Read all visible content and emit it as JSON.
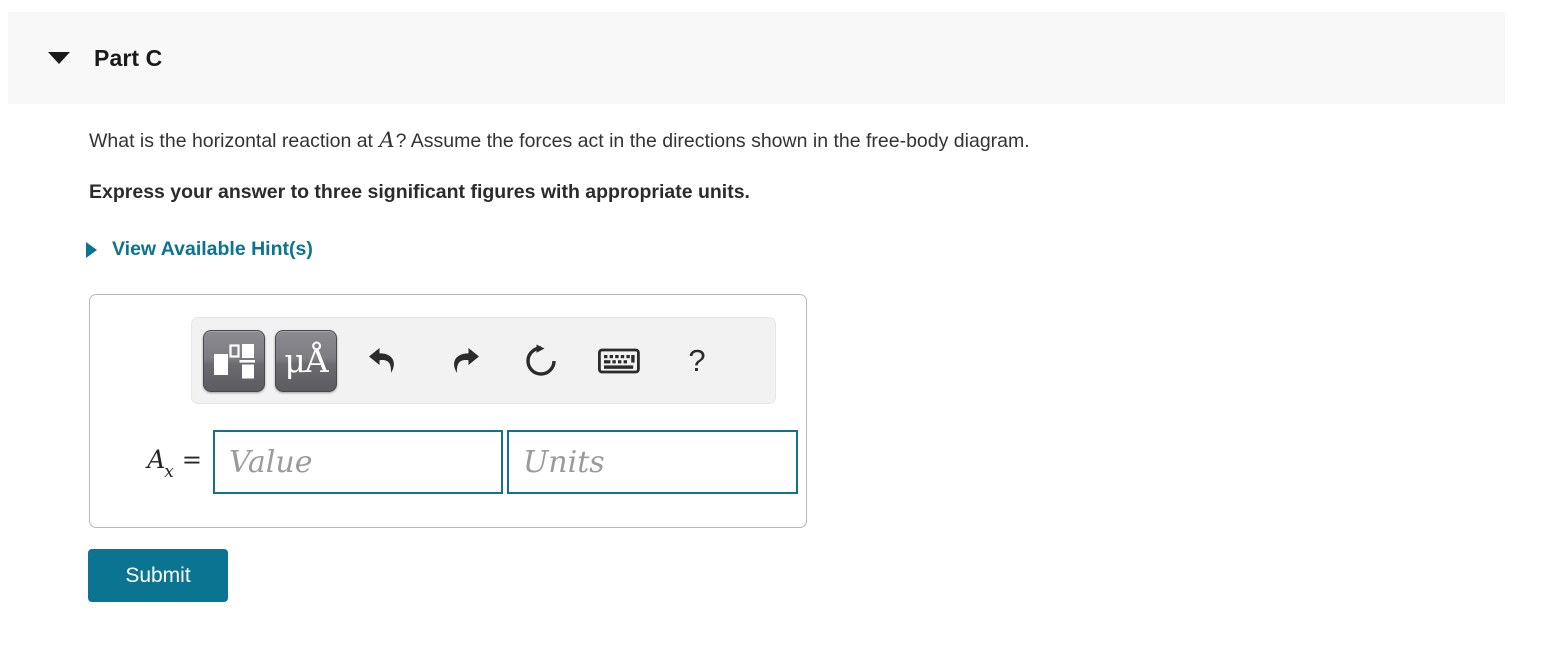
{
  "header": {
    "title": "Part C",
    "collapse_icon": "triangle-down-icon",
    "expanded": true,
    "background": "#f8f8f8"
  },
  "question": {
    "prompt_before_var": "What is the horizontal reaction at ",
    "prompt_variable": "A",
    "prompt_after_var": "? Assume the forces act in the directions shown in the free-body diagram.",
    "instruction": "Express your answer to three significant figures with appropriate units."
  },
  "hints": {
    "label": "View Available Hint(s)",
    "expand_icon": "triangle-right-icon",
    "color": "#0b7490"
  },
  "answer": {
    "toolbar": {
      "buttons": [
        {
          "name": "math-template-button",
          "icon": "math-template-icon",
          "label": ""
        },
        {
          "name": "units-button",
          "icon": "micro-angstrom-icon",
          "label": "μÅ"
        },
        {
          "name": "undo-button",
          "icon": "undo-arrow-icon",
          "label": ""
        },
        {
          "name": "redo-button",
          "icon": "redo-arrow-icon",
          "label": ""
        },
        {
          "name": "reset-button",
          "icon": "reset-circular-arrow-icon",
          "label": ""
        },
        {
          "name": "keyboard-button",
          "icon": "keyboard-icon",
          "label": ""
        },
        {
          "name": "help-button",
          "icon": "question-mark-icon",
          "label": "?"
        }
      ]
    },
    "variable_base": "A",
    "variable_subscript": "x",
    "equals": "=",
    "value_placeholder": "Value",
    "value_current": "",
    "units_placeholder": "Units",
    "units_current": "",
    "field_border_color": "#14708d"
  },
  "actions": {
    "submit_label": "Submit",
    "submit_color": "#0b7490"
  }
}
